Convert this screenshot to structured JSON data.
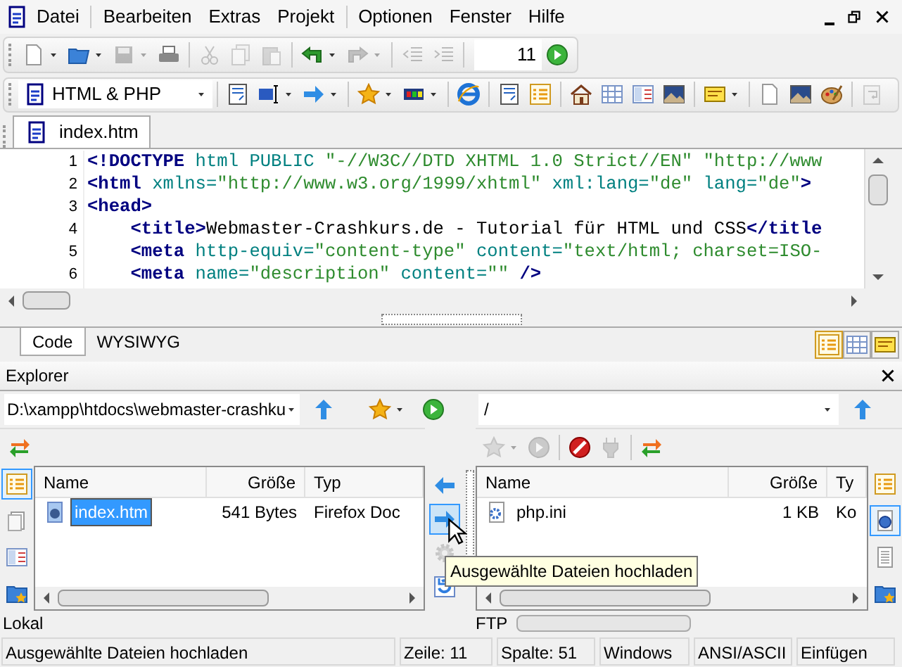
{
  "menu": {
    "items": [
      {
        "label": "Datei",
        "divider_before": false
      },
      {
        "label": "Bearbeiten",
        "divider_before": true
      },
      {
        "label": "Extras",
        "divider_before": false
      },
      {
        "label": "Projekt",
        "divider_before": false
      },
      {
        "label": "Optionen",
        "divider_before": true
      },
      {
        "label": "Fenster",
        "divider_before": false
      },
      {
        "label": "Hilfe",
        "divider_before": false
      }
    ]
  },
  "toolbar": {
    "buttons": [
      {
        "disabled": false
      },
      {
        "disabled": false
      },
      {
        "disabled": true
      },
      {
        "disabled": false
      },
      {
        "disabled": true
      },
      {
        "disabled": true
      },
      {
        "disabled": true
      },
      {
        "disabled": false
      },
      {
        "disabled": true
      },
      {
        "disabled": true
      },
      {
        "disabled": true
      }
    ],
    "line_field": "11"
  },
  "language": {
    "value": "HTML & PHP"
  },
  "document_tabs": [
    {
      "label": "index.htm",
      "selected": true
    }
  ],
  "editor": {
    "lines": [
      {
        "number": "1",
        "tokens": [
          {
            "kind": "tag",
            "text": "<!DOCTYPE"
          },
          {
            "kind": "attr",
            "text": " html PUBLIC "
          },
          {
            "kind": "value",
            "text": "\"-//W3C//DTD XHTML 1.0 Strict//EN\" \"http://www"
          }
        ]
      },
      {
        "number": "2",
        "tokens": [
          {
            "kind": "tag",
            "text": "<html"
          },
          {
            "kind": "attr",
            "text": " xmlns="
          },
          {
            "kind": "value",
            "text": "\"http://www.w3.org/1999/xhtml\""
          },
          {
            "kind": "attr",
            "text": " xml:lang="
          },
          {
            "kind": "value",
            "text": "\"de\""
          },
          {
            "kind": "attr",
            "text": " lang="
          },
          {
            "kind": "value",
            "text": "\"de\""
          },
          {
            "kind": "tag",
            "text": ">"
          }
        ]
      },
      {
        "number": "3",
        "tokens": [
          {
            "kind": "tag",
            "text": "<head>"
          }
        ]
      },
      {
        "number": "4",
        "tokens": [
          {
            "kind": "tag",
            "text": "    <title>"
          },
          {
            "kind": "plain",
            "text": "Webmaster-Crashkurs.de - Tutorial für HTML und CSS"
          },
          {
            "kind": "tag",
            "text": "</title"
          }
        ]
      },
      {
        "number": "5",
        "tokens": [
          {
            "kind": "tag",
            "text": "    <meta"
          },
          {
            "kind": "attr",
            "text": " http-equiv="
          },
          {
            "kind": "value",
            "text": "\"content-type\""
          },
          {
            "kind": "attr",
            "text": " content="
          },
          {
            "kind": "value",
            "text": "\"text/html; charset=ISO-"
          }
        ]
      },
      {
        "number": "6",
        "tokens": [
          {
            "kind": "tag",
            "text": "    <meta"
          },
          {
            "kind": "attr",
            "text": " name="
          },
          {
            "kind": "value",
            "text": "\"description\""
          },
          {
            "kind": "attr",
            "text": " content="
          },
          {
            "kind": "value",
            "text": "\"\""
          },
          {
            "kind": "tag",
            "text": " />"
          }
        ]
      }
    ]
  },
  "view_tabs": [
    {
      "label": "Code",
      "selected": true
    },
    {
      "label": "WYSIWYG",
      "selected": false
    }
  ],
  "view_buttons": [
    {
      "selected": true
    },
    {
      "selected": false
    },
    {
      "selected": false
    }
  ],
  "explorer": {
    "title": "Explorer",
    "local": {
      "path": "D:\\xampp\\htdocs\\webmaster-crashku",
      "label": "Lokal",
      "columns": [
        "Name",
        "Größe",
        "Typ"
      ],
      "files": [
        {
          "name": "index.htm",
          "size": "541 Bytes",
          "type": "Firefox Doc",
          "selected": true
        }
      ],
      "view_buttons": [
        {
          "selected": true
        },
        {
          "selected": false
        },
        {
          "selected": false
        },
        {
          "selected": false
        }
      ]
    },
    "transfer_buttons": [
      {
        "hovered": false,
        "disabled": false
      },
      {
        "hovered": true,
        "disabled": false
      },
      {
        "hovered": false,
        "disabled": true
      },
      {
        "hovered": false,
        "disabled": false
      }
    ],
    "remote": {
      "path": "/",
      "label": "FTP",
      "level": 0,
      "columns": [
        "Name",
        "Größe",
        "Ty"
      ],
      "toolbar": [
        {
          "disabled": true
        },
        {
          "disabled": true
        },
        {
          "disabled": false
        },
        {
          "disabled": true
        },
        {
          "disabled": false
        }
      ],
      "files": [
        {
          "name": "php.ini",
          "size": "1 KB",
          "type": "Ko",
          "selected": false
        }
      ],
      "view_buttons": [
        {
          "selected": false
        },
        {
          "selected": true
        },
        {
          "selected": false
        },
        {
          "selected": false
        }
      ]
    }
  },
  "tooltip": "Ausgewählte Dateien hochladen",
  "status_bar": [
    "Ausgewählte Dateien hochladen",
    "Zeile: 11",
    "Spalte: 51",
    "Windows",
    "ANSI/ASCII",
    "Einfügen"
  ]
}
